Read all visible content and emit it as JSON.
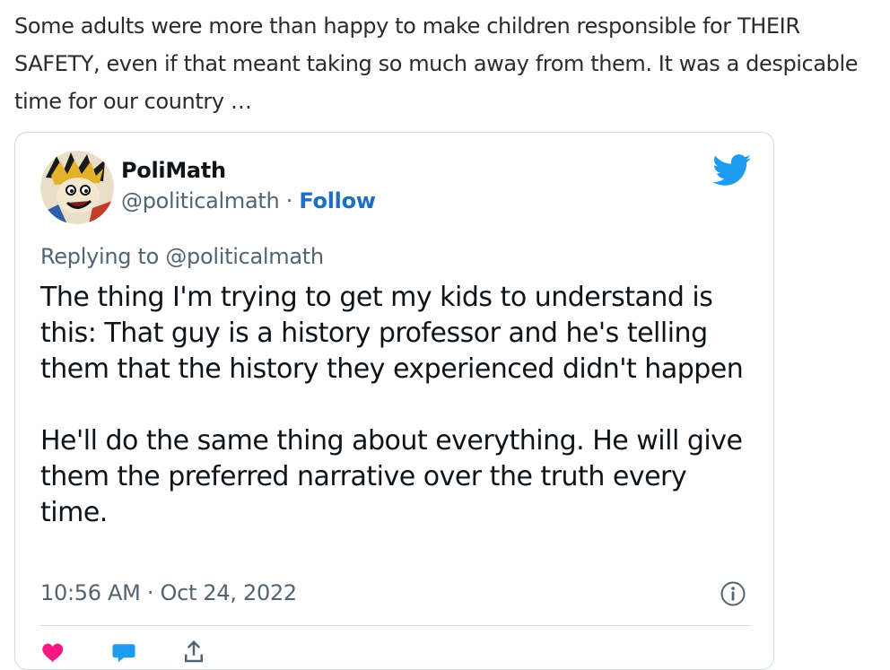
{
  "post": {
    "intro_text": "Some adults were more than happy to make children responsible for THEIR SAFETY, even if that meant taking so much away from them. It was a despicable time for our country …"
  },
  "tweet": {
    "author_name": "PoliMath",
    "handle": "@politicalmath",
    "separator": " · ",
    "follow_label": "Follow",
    "replying_to": "Replying to @politicalmath",
    "body_paragraphs": [
      "The thing I'm trying to get my kids to understand is this: That guy is a history professor and he's telling them that the history they experienced didn't happen",
      "He'll do the same thing about everything. He will give them the preferred narrative over the truth every time."
    ],
    "timestamp": "10:56 AM · Oct 24, 2022",
    "icons": {
      "brand": "twitter-bird-icon",
      "info": "info-icon",
      "like": "heart-icon",
      "reply": "reply-bubble-icon",
      "share": "share-icon"
    },
    "colors": {
      "brand": "#1d9bf0",
      "link": "#1d6ec5",
      "like": "#f91880",
      "muted": "#536471"
    }
  }
}
